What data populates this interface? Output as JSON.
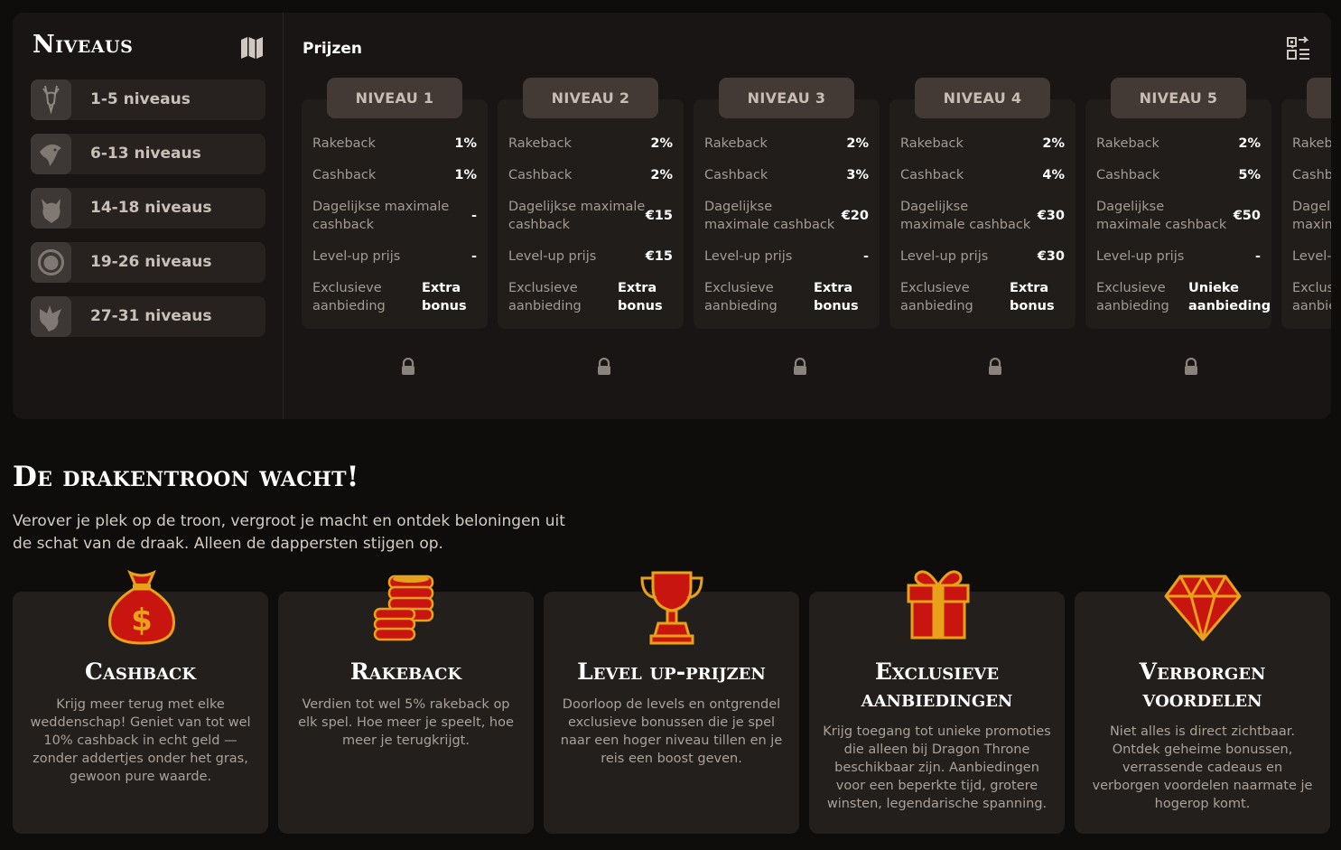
{
  "sidebar": {
    "title": "Niveaus",
    "items": [
      {
        "label": "1-5 niveaus"
      },
      {
        "label": "6-13 niveaus"
      },
      {
        "label": "14-18 niveaus"
      },
      {
        "label": "19-26 niveaus"
      },
      {
        "label": "27-31 niveaus"
      }
    ]
  },
  "prizes": {
    "title": "Prijzen",
    "labels": {
      "rakeback": "Rakeback",
      "cashback": "Cashback",
      "daily": "Dagelijkse maximale cashback",
      "levelup": "Level-up prijs",
      "exclusive": "Exclusieve aanbieding"
    },
    "levels": [
      {
        "name": "NIVEAU 1",
        "rakeback": "1%",
        "cashback": "1%",
        "daily": "-",
        "levelup": "-",
        "exclusive": "Extra bonus"
      },
      {
        "name": "NIVEAU 2",
        "rakeback": "2%",
        "cashback": "2%",
        "daily": "€15",
        "levelup": "€15",
        "exclusive": "Extra bonus"
      },
      {
        "name": "NIVEAU 3",
        "rakeback": "2%",
        "cashback": "3%",
        "daily": "€20",
        "levelup": "-",
        "exclusive": "Extra bonus"
      },
      {
        "name": "NIVEAU 4",
        "rakeback": "2%",
        "cashback": "4%",
        "daily": "€30",
        "levelup": "€30",
        "exclusive": "Extra bonus"
      },
      {
        "name": "NIVEAU 5",
        "rakeback": "2%",
        "cashback": "5%",
        "daily": "€50",
        "levelup": "-",
        "exclusive": "Unieke aanbieding"
      }
    ]
  },
  "section": {
    "title": "De drakentroon wacht!",
    "intro": "Verover je plek op de troon, vergroot je macht en ontdek beloningen uit de schat van de draak. Alleen de dappersten stijgen op."
  },
  "features": [
    {
      "icon": "money-bag-icon",
      "title": "Cashback",
      "text": "Krijg meer terug met elke weddenschap! Geniet van tot wel 10% cashback in echt geld — zonder addertjes onder het gras, gewoon pure waarde."
    },
    {
      "icon": "coins-stack-icon",
      "title": "Rakeback",
      "text": "Verdien tot wel 5% rakeback op elk spel. Hoe meer je speelt, hoe meer je terugkrijgt."
    },
    {
      "icon": "trophy-icon",
      "title": "Level up-prijzen",
      "text": "Doorloop de levels en ontgrendel exclusieve bonussen die je spel naar een hoger niveau tillen en je reis een boost geven."
    },
    {
      "icon": "gift-icon",
      "title": "Exclusieve aanbiedingen",
      "text": "Krijg toegang tot unieke promoties die alleen bij Dragon Throne beschikbaar zijn. Aanbiedingen voor een beperkte tijd, grotere winsten, legendarische spanning."
    },
    {
      "icon": "gem-icon",
      "title": "Verborgen voordelen",
      "text": "Niet alles is direct zichtbaar. Ontdek geheime bonussen, verrassende cadeaus en verborgen voordelen naarmate je hogerop komt."
    }
  ],
  "colors": {
    "gold": "#e8a21a",
    "red": "#c8150f",
    "background": "#0f0d0c",
    "panel": "#181514",
    "card": "#231f1d"
  }
}
